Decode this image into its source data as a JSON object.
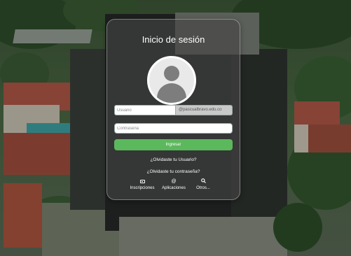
{
  "login": {
    "title": "Inicio de sesión",
    "username_placeholder": "Usuario",
    "domain_suffix": "@pascualbravo.edu.co",
    "password_placeholder": "Contraseña",
    "submit_label": "Ingresar",
    "forgot_user": "¿Olvidaste tu Usuario?",
    "forgot_password": "¿Olvidaste tu contraseña?"
  },
  "nav": [
    {
      "icon": "id-card-icon",
      "label": "Inscripciones"
    },
    {
      "icon": "at-sign-icon",
      "glyph": "@",
      "label": "Aplicaciones"
    },
    {
      "icon": "search-icon",
      "glyph": "🔍",
      "label": "Otros..."
    }
  ],
  "colors": {
    "submit": "#5cb85c",
    "card": "rgba(70,70,70,0.62)"
  }
}
